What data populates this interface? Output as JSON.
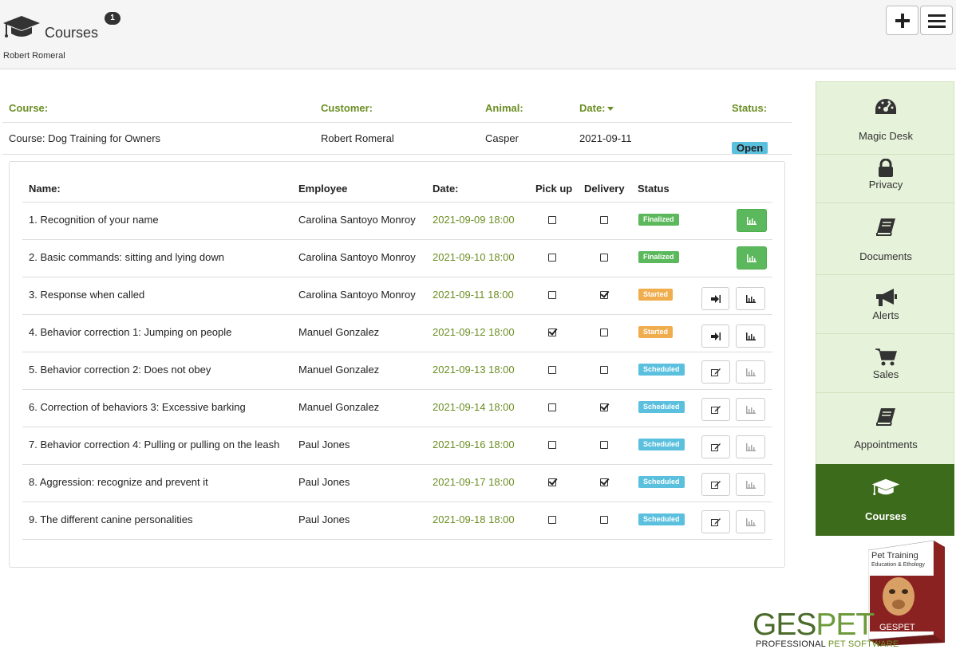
{
  "header": {
    "title": "Courses",
    "notification_count": "1",
    "subtitle": "Robert Romeral"
  },
  "summary": {
    "headers": {
      "course": "Course:",
      "customer": "Customer:",
      "animal": "Animal:",
      "date": "Date:",
      "status": "Status:"
    },
    "row": {
      "course": "Course: Dog Training for Owners",
      "customer": "Robert Romeral",
      "animal": "Casper",
      "date": "2021-09-11",
      "status": "Open"
    }
  },
  "sessions": {
    "headers": {
      "name": "Name:",
      "employee": "Employee",
      "date": "Date:",
      "pickup": "Pick up",
      "delivery": "Delivery",
      "status": "Status"
    },
    "rows": [
      {
        "name": "1. Recognition of your name",
        "employee": "Carolina Santoyo Monroy",
        "date": "2021-09-09 18:00",
        "pickup": false,
        "delivery": false,
        "status": "Finalized"
      },
      {
        "name": "2. Basic commands: sitting and lying down",
        "employee": "Carolina Santoyo Monroy",
        "date": "2021-09-10 18:00",
        "pickup": false,
        "delivery": false,
        "status": "Finalized"
      },
      {
        "name": "3. Response when called",
        "employee": "Carolina Santoyo Monroy",
        "date": "2021-09-11 18:00",
        "pickup": false,
        "delivery": true,
        "status": "Started"
      },
      {
        "name": "4. Behavior correction 1: Jumping on people",
        "employee": "Manuel Gonzalez",
        "date": "2021-09-12 18:00",
        "pickup": true,
        "delivery": false,
        "status": "Started"
      },
      {
        "name": "5. Behavior correction 2: Does not obey",
        "employee": "Manuel Gonzalez",
        "date": "2021-09-13 18:00",
        "pickup": false,
        "delivery": false,
        "status": "Scheduled"
      },
      {
        "name": "6. Correction of behaviors 3: Excessive barking",
        "employee": "Manuel Gonzalez",
        "date": "2021-09-14 18:00",
        "pickup": false,
        "delivery": true,
        "status": "Scheduled"
      },
      {
        "name": "7. Behavior correction 4: Pulling or pulling on the leash",
        "employee": "Paul Jones",
        "date": "2021-09-16 18:00",
        "pickup": false,
        "delivery": false,
        "status": "Scheduled"
      },
      {
        "name": "8. Aggression: recognize and prevent it",
        "employee": "Paul Jones",
        "date": "2021-09-17 18:00",
        "pickup": true,
        "delivery": true,
        "status": "Scheduled"
      },
      {
        "name": "9. The different canine personalities",
        "employee": "Paul Jones",
        "date": "2021-09-18 18:00",
        "pickup": false,
        "delivery": false,
        "status": "Scheduled"
      }
    ]
  },
  "sidebar": {
    "items": [
      {
        "label": "Magic Desk",
        "icon": "dashboard-icon"
      },
      {
        "label": "Privacy",
        "icon": "lock-icon"
      },
      {
        "label": "Documents",
        "icon": "book-icon"
      },
      {
        "label": "Alerts",
        "icon": "megaphone-icon"
      },
      {
        "label": "Sales",
        "icon": "cart-icon"
      },
      {
        "label": "Appointments",
        "icon": "book-icon"
      },
      {
        "label": "Courses",
        "icon": "graduation-cap-icon"
      }
    ]
  },
  "brand": {
    "name_part1": "GES",
    "name_part2": "PET",
    "tag_part1": "PROFESSIONAL ",
    "tag_part2": "PET SOFTWARE",
    "product_title": "Pet Training",
    "product_subtitle": "Education & Ethology",
    "product_brand": "GESPET"
  },
  "colors": {
    "accent_green": "#6b8e23",
    "finalized": "#5cb85c",
    "started": "#f0ad4e",
    "scheduled": "#5bc0de",
    "sidebar_bg": "#e6f2da",
    "sidebar_active": "#3d6b1c"
  }
}
